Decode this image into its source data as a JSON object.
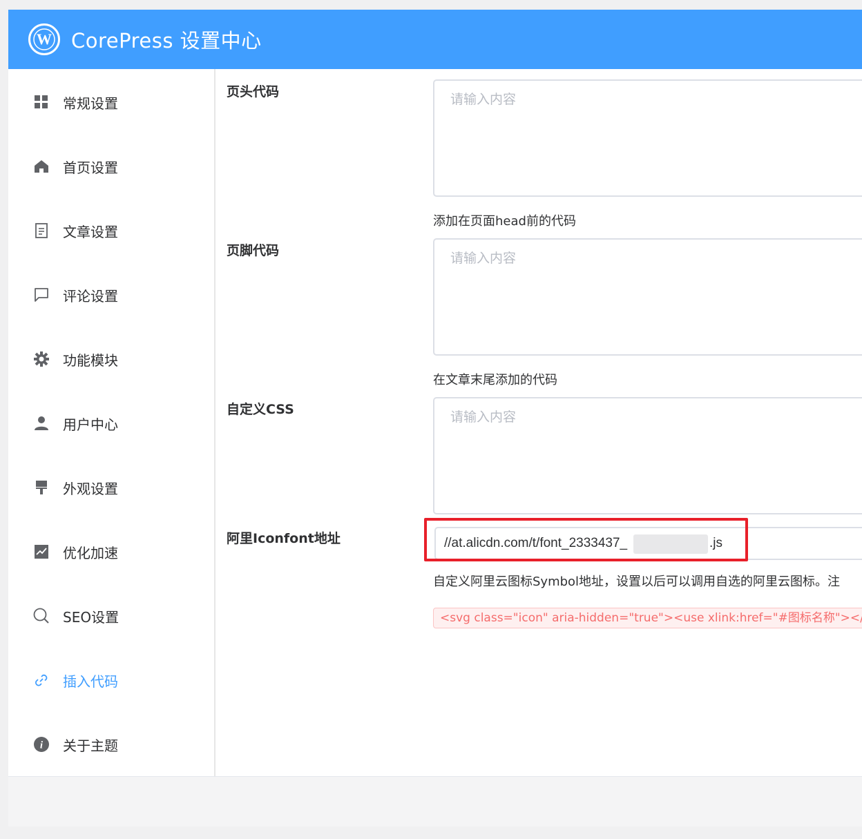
{
  "header": {
    "title": "CorePress 设置中心",
    "logo_icon": "wordpress-logo-icon",
    "color": "#409eff"
  },
  "sidebar": {
    "active_color": "#409eff",
    "items": [
      {
        "label": "常规设置",
        "icon": "grid-icon"
      },
      {
        "label": "首页设置",
        "icon": "home-icon"
      },
      {
        "label": "文章设置",
        "icon": "document-icon"
      },
      {
        "label": "评论设置",
        "icon": "comment-icon"
      },
      {
        "label": "功能模块",
        "icon": "gear-icon"
      },
      {
        "label": "用户中心",
        "icon": "user-icon"
      },
      {
        "label": "外观设置",
        "icon": "paint-brush-icon"
      },
      {
        "label": "优化加速",
        "icon": "chart-icon"
      },
      {
        "label": "SEO设置",
        "icon": "search-icon"
      },
      {
        "label": "插入代码",
        "icon": "link-icon",
        "active": true
      },
      {
        "label": "关于主题",
        "icon": "info-icon"
      }
    ]
  },
  "main": {
    "header_code": {
      "label": "页头代码",
      "placeholder": "请输入内容",
      "help": "添加在页面head前的代码"
    },
    "footer_code": {
      "label": "页脚代码",
      "placeholder": "请输入内容",
      "help": "在文章末尾添加的代码"
    },
    "custom_css": {
      "label": "自定义CSS",
      "placeholder": "请输入内容"
    },
    "iconfont": {
      "label": "阿里Iconfont地址",
      "value_prefix": "//at.alicdn.com/t/font_2333437_",
      "value_suffix": ".js",
      "help": "自定义阿里云图标Symbol地址，设置以后可以调用自选的阿里云图标。注",
      "code_example": "<svg class=\"icon\" aria-hidden=\"true\"><use xlink:href=\"#图标名称\"></use></svg>"
    }
  }
}
